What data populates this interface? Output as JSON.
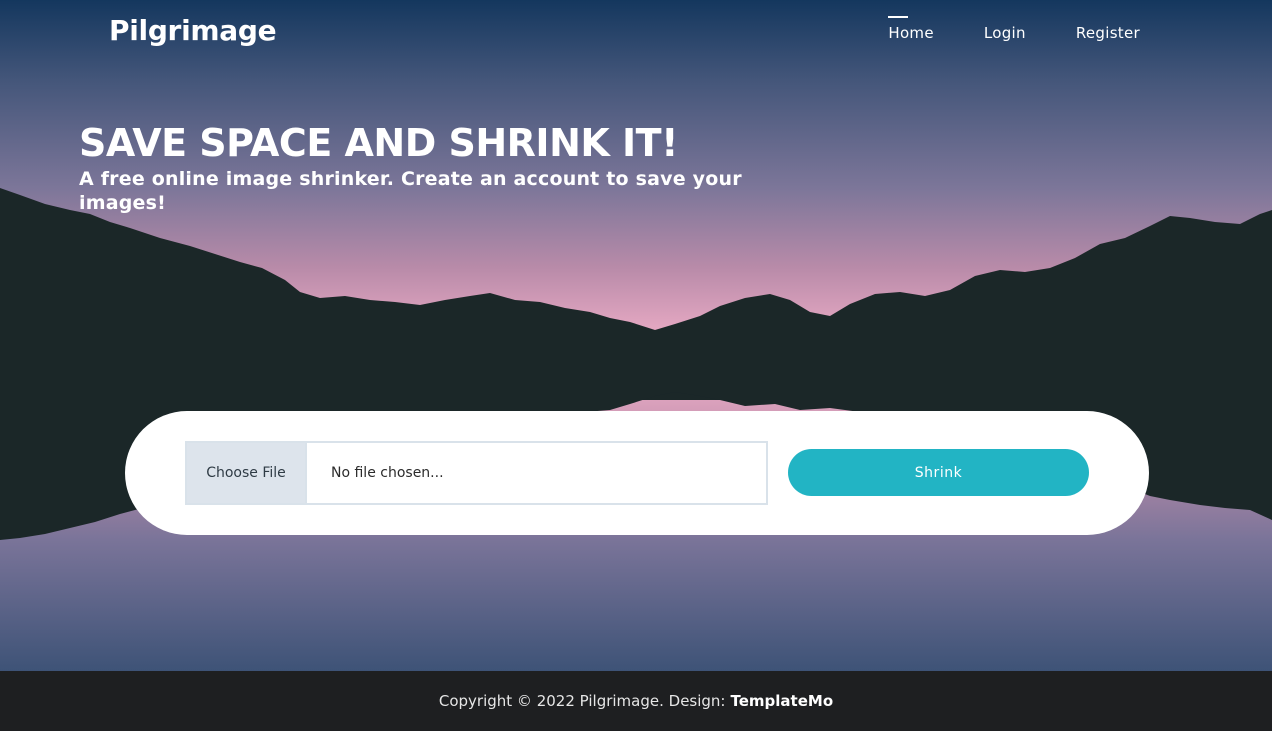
{
  "brand": {
    "name": "Pilgrimage"
  },
  "nav": {
    "items": [
      {
        "label": "Home",
        "active": true
      },
      {
        "label": "Login",
        "active": false
      },
      {
        "label": "Register",
        "active": false
      }
    ]
  },
  "hero": {
    "title": "SAVE SPACE AND SHRINK IT!",
    "subtitle": "A free online image shrinker. Create an account to save your images!"
  },
  "upload": {
    "choose_label": "Choose File",
    "file_status": "No file chosen...",
    "submit_label": "Shrink"
  },
  "footer": {
    "copyright": "Copyright © 2022 Pilgrimage. Design:",
    "credit": "TemplateMo"
  },
  "colors": {
    "accent": "#22b4c4",
    "footer_bg": "#1e1f21",
    "mountain": "#1b2728"
  }
}
